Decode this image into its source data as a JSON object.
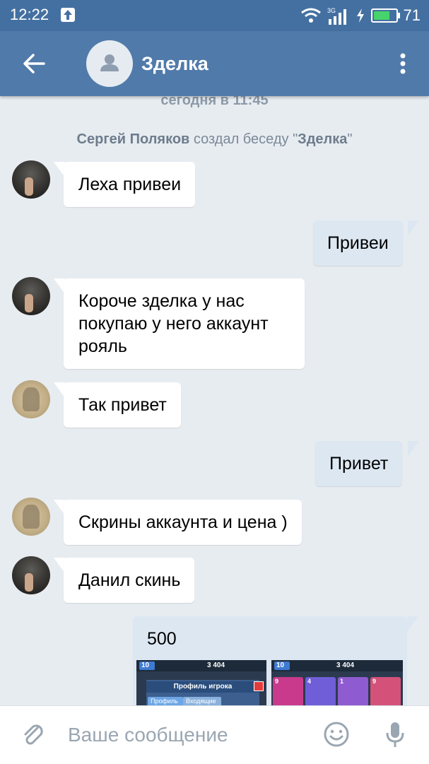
{
  "status_bar": {
    "time": "12:22",
    "battery": "71",
    "network": "3G"
  },
  "app_bar": {
    "title": "Зделка",
    "icons": [
      "back-arrow-icon",
      "group-avatar-icon",
      "more-vert-icon"
    ]
  },
  "chat": {
    "date_separator": "сегодня в 11:45",
    "system_message": {
      "author": "Сергей Поляков",
      "action": "создал беседу",
      "chat_name": "Зделка"
    },
    "messages": [
      {
        "direction": "in",
        "avatar": "dark",
        "lines": [
          "Леха привеи"
        ]
      },
      {
        "direction": "out",
        "lines": [
          "Привеи"
        ]
      },
      {
        "direction": "in",
        "avatar": "dark",
        "lines": [
          "Короче зделка у нас",
          "покупаю у него аккаунт",
          "рояль"
        ]
      },
      {
        "direction": "in",
        "avatar": "old",
        "lines": [
          "Так привет"
        ]
      },
      {
        "direction": "out",
        "lines": [
          "Привет"
        ]
      },
      {
        "direction": "in",
        "avatar": "old",
        "lines": [
          "Скрины аккаунта и цена )"
        ]
      },
      {
        "direction": "in",
        "avatar": "dark",
        "lines": [
          "Данил скинь"
        ]
      },
      {
        "direction": "out",
        "lines": [
          "500"
        ],
        "attachment": {
          "images": [
            {
              "level": "10",
              "coins": "3 404",
              "panel_title": "Профиль игрока",
              "tabs": [
                "Профиль",
                "Входящие"
              ]
            },
            {
              "level": "10",
              "coins": "3 404",
              "card_levels": [
                "9",
                "4",
                "1",
                "9"
              ]
            }
          ]
        }
      }
    ]
  },
  "input_bar": {
    "placeholder": "Ваше сообщение",
    "icons": [
      "attach-icon",
      "emoji-icon",
      "mic-icon"
    ]
  },
  "colors": {
    "header": "#507aaa",
    "status_bar": "#4470a1",
    "chat_bg": "#e7ecf1",
    "bubble_out": "#dde7f2",
    "bubble_in": "#ffffff"
  }
}
